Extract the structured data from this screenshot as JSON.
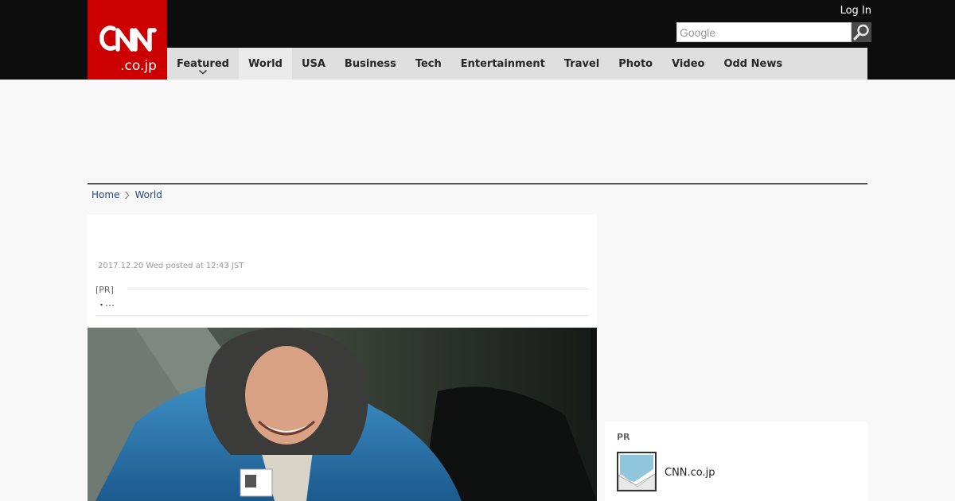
{
  "header": {
    "logo_text_main": "CNN",
    "logo_text_sub": ".co.jp",
    "login_label": "Log In",
    "search": {
      "placeholder": "Google"
    },
    "nav": [
      {
        "label": "Featured",
        "has_dropdown": true
      },
      {
        "label": "World",
        "active": true
      },
      {
        "label": "USA"
      },
      {
        "label": "Business"
      },
      {
        "label": "Tech"
      },
      {
        "label": "Entertainment"
      },
      {
        "label": "Travel"
      },
      {
        "label": "Photo"
      },
      {
        "label": "Video"
      },
      {
        "label": "Odd News"
      }
    ],
    "colors": {
      "brand": "#cc0000",
      "bar": "#0d0d0d",
      "nav_bg": "#dfdfdf"
    }
  },
  "breadcrumb": [
    {
      "label": "Home"
    },
    {
      "label": "World"
    }
  ],
  "article": {
    "posted": "2017.12.20 Wed posted at 12:43 JST",
    "pr_label": "[PR]",
    "pr_bullet": "・",
    "pr_link": "…",
    "photo_credit_icon": "photo-credit-watermark"
  },
  "sidebar": {
    "pr_label": "PR",
    "items": [
      {
        "label": "CNN.co.jp",
        "icon": "mail-thumbnail-icon"
      }
    ]
  }
}
